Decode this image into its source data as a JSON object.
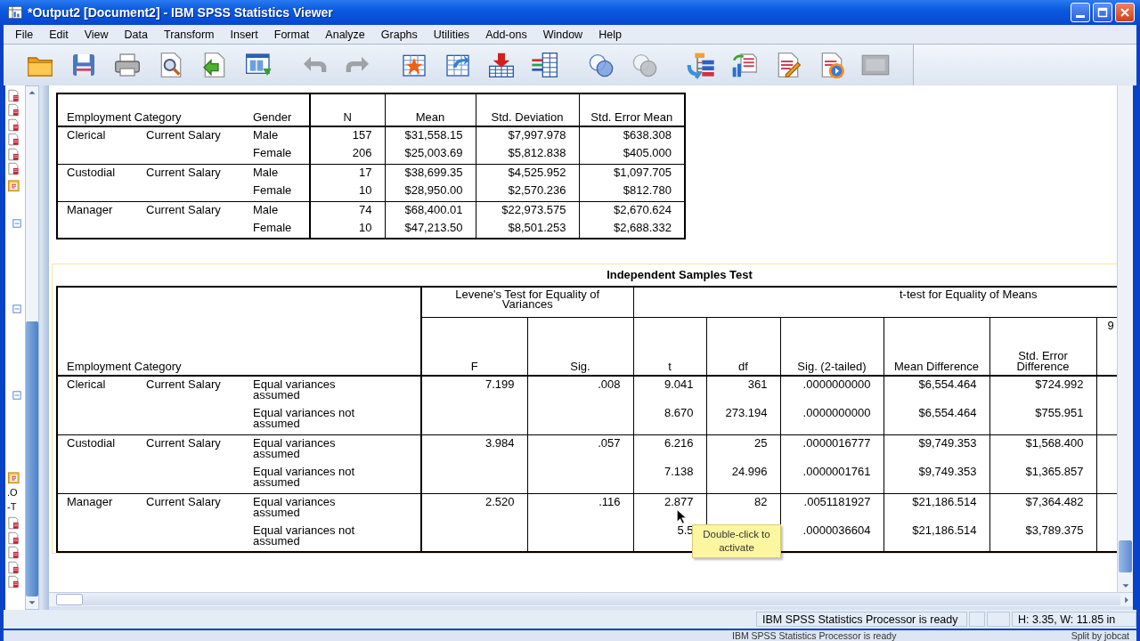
{
  "window": {
    "title": "*Output2 [Document2] - IBM SPSS Statistics Viewer"
  },
  "menu": [
    "File",
    "Edit",
    "View",
    "Data",
    "Transform",
    "Insert",
    "Format",
    "Analyze",
    "Graphs",
    "Utilities",
    "Add-ons",
    "Window",
    "Help"
  ],
  "toolbar": [
    {
      "disabled": false
    },
    {
      "disabled": false
    },
    {
      "disabled": false
    },
    {
      "disabled": false
    },
    {
      "disabled": false
    },
    {
      "disabled": false
    },
    {
      "disabled": true
    },
    {
      "disabled": true
    },
    {
      "disabled": false
    },
    {
      "disabled": false
    },
    {
      "disabled": false
    },
    {
      "disabled": false
    },
    {
      "disabled": false
    },
    {
      "disabled": true
    },
    {
      "disabled": false
    },
    {
      "disabled": false
    },
    {
      "disabled": false
    },
    {
      "disabled": false
    },
    {
      "disabled": true
    }
  ],
  "outline": {
    "labels": [
      ".O",
      "-T"
    ]
  },
  "group_statistics": {
    "columns": [
      "Employment Category",
      "Gender",
      "N",
      "Mean",
      "Std. Deviation",
      "Std. Error Mean"
    ],
    "groups": [
      {
        "category": "Clerical",
        "variable": "Current Salary",
        "rows": [
          {
            "gender": "Male",
            "n": "157",
            "mean": "$31,558.15",
            "sd": "$7,997.978",
            "se": "$638.308"
          },
          {
            "gender": "Female",
            "n": "206",
            "mean": "$25,003.69",
            "sd": "$5,812.838",
            "se": "$405.000"
          }
        ]
      },
      {
        "category": "Custodial",
        "variable": "Current Salary",
        "rows": [
          {
            "gender": "Male",
            "n": "17",
            "mean": "$38,699.35",
            "sd": "$4,525.952",
            "se": "$1,097.705"
          },
          {
            "gender": "Female",
            "n": "10",
            "mean": "$28,950.00",
            "sd": "$2,570.236",
            "se": "$812.780"
          }
        ]
      },
      {
        "category": "Manager",
        "variable": "Current Salary",
        "rows": [
          {
            "gender": "Male",
            "n": "74",
            "mean": "$68,400.01",
            "sd": "$22,973.575",
            "se": "$2,670.624"
          },
          {
            "gender": "Female",
            "n": "10",
            "mean": "$47,213.50",
            "sd": "$8,501.253",
            "se": "$2,688.332"
          }
        ]
      }
    ]
  },
  "independent_samples_test": {
    "title": "Independent Samples Test",
    "row_header": "Employment Category",
    "column_groups": [
      "Levene's Test for Equality of Variances",
      "t-test for Equality of Means"
    ],
    "columns": [
      "F",
      "Sig.",
      "t",
      "df",
      "Sig. (2-tailed)",
      "Mean Difference",
      "Std. Error Difference",
      "9"
    ],
    "groups": [
      {
        "category": "Clerical",
        "variable": "Current Salary",
        "rows": [
          {
            "assumption": "Equal variances assumed",
            "f": "7.199",
            "sig": ".008",
            "t": "9.041",
            "df": "361",
            "sig2": ".0000000000",
            "md": "$6,554.464",
            "sed": "$724.992"
          },
          {
            "assumption": "Equal variances not assumed",
            "t": "8.670",
            "df": "273.194",
            "sig2": ".0000000000",
            "md": "$6,554.464",
            "sed": "$755.951"
          }
        ]
      },
      {
        "category": "Custodial",
        "variable": "Current Salary",
        "rows": [
          {
            "assumption": "Equal variances assumed",
            "f": "3.984",
            "sig": ".057",
            "t": "6.216",
            "df": "25",
            "sig2": ".0000016777",
            "md": "$9,749.353",
            "sed": "$1,568.400"
          },
          {
            "assumption": "Equal variances not assumed",
            "t": "7.138",
            "df": "24.996",
            "sig2": ".0000001761",
            "md": "$9,749.353",
            "sed": "$1,365.857"
          }
        ]
      },
      {
        "category": "Manager",
        "variable": "Current Salary",
        "rows": [
          {
            "assumption": "Equal variances assumed",
            "f": "2.520",
            "sig": ".116",
            "t": "2.877",
            "df": "82",
            "sig2": ".0051181927",
            "md": "$21,186.514",
            "sed": "$7,364.482"
          },
          {
            "assumption": "Equal variances not assumed",
            "t": "5.5",
            "sig2": ".0000036604",
            "md": "$21,186.514",
            "sed": "$3,789.375"
          }
        ]
      }
    ]
  },
  "tooltip": "Double-click to activate",
  "status_bar": {
    "message": "IBM SPSS Statistics Processor is ready",
    "size": "H: 3.35, W: 11.85 in"
  },
  "background_window_status": {
    "message": "IBM SPSS Statistics Processor is ready",
    "split": "Split by jobcat"
  }
}
